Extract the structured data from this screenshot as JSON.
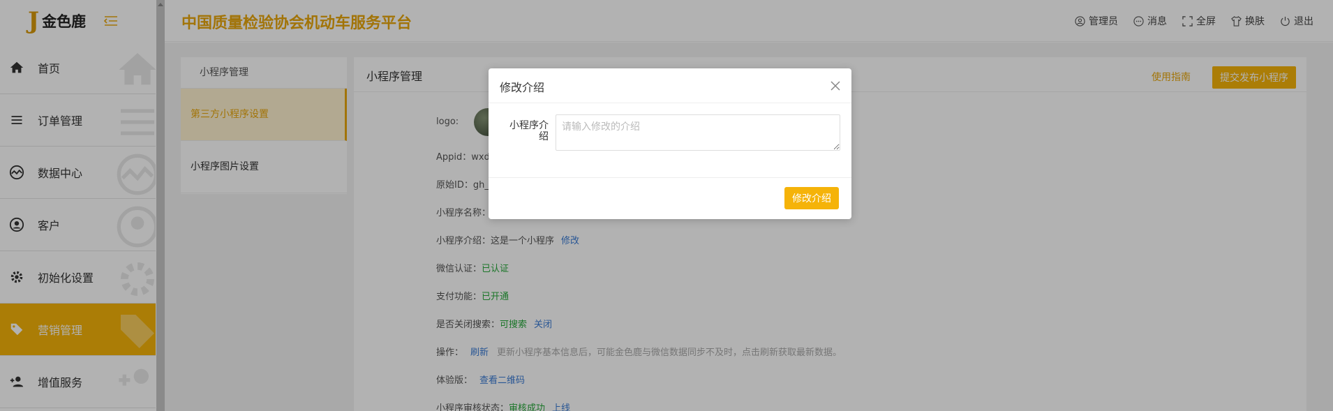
{
  "sidebar": {
    "logo_mark": "J",
    "logo_text": "金色鹿",
    "items": [
      {
        "label": "首页",
        "icon": "home-icon"
      },
      {
        "label": "订单管理",
        "icon": "list-icon"
      },
      {
        "label": "数据中心",
        "icon": "chart-icon"
      },
      {
        "label": "客户",
        "icon": "user-icon"
      },
      {
        "label": "初始化设置",
        "icon": "gear-icon"
      },
      {
        "label": "营销管理",
        "icon": "tag-icon",
        "active": true
      },
      {
        "label": "增值服务",
        "icon": "add-user-icon"
      }
    ]
  },
  "header": {
    "title": "中国质量检验协会机动车服务平台",
    "actions": [
      {
        "label": "管理员",
        "icon": "user-circle-icon"
      },
      {
        "label": "消息",
        "icon": "message-icon"
      },
      {
        "label": "全屏",
        "icon": "fullscreen-icon"
      },
      {
        "label": "换肤",
        "icon": "shirt-icon"
      },
      {
        "label": "退出",
        "icon": "power-icon"
      }
    ]
  },
  "submenu": {
    "head": "小程序管理",
    "items": [
      {
        "label": "第三方小程序设置",
        "active": true
      },
      {
        "label": "小程序图片设置",
        "active": false
      }
    ]
  },
  "main": {
    "title": "小程序管理",
    "guide": "使用指南",
    "publish": "提交发布小程序",
    "info": {
      "logo_label": "logo:",
      "appid_label": "Appid：wxd",
      "origin_label": "原始ID：gh_",
      "name_label": "小程序名称：",
      "intro_label": "小程序介绍：这是一个小程序",
      "intro_edit": "修改",
      "wechat_label": "微信认证：",
      "wechat_value": "已认证",
      "pay_label": "支付功能：",
      "pay_value": "已开通",
      "search_label": "是否关闭搜索：",
      "search_value": "可搜索",
      "search_action": "关闭",
      "op_label": "操作：",
      "op_action": "刷新",
      "op_hint": "更新小程序基本信息后，可能金色鹿与微信数据同步不及时，点击刷新获取最新数据。",
      "trial_label": "体验版：",
      "trial_action": "查看二维码",
      "audit_label": "小程序审核状态：",
      "audit_value": "审核成功",
      "audit_action": "上线"
    }
  },
  "modal": {
    "title": "修改介绍",
    "field_label": "小程序介绍",
    "placeholder": "请输入修改的介绍",
    "value": "",
    "confirm": "修改介绍"
  },
  "colors": {
    "accent": "#f5b309",
    "title": "#e8a70c",
    "success": "#26a83a",
    "link": "#3a7bd5"
  }
}
